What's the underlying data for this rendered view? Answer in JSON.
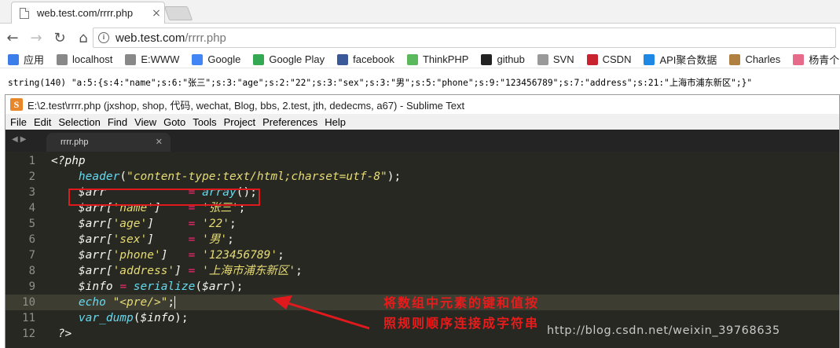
{
  "browser": {
    "tab_title": "web.test.com/rrrr.php",
    "url_host": "web.test.com",
    "url_path": "/rrrr.php",
    "bookmarks": [
      {
        "label": "应用",
        "icon": "apps-grid-icon",
        "color": "#3b7de9"
      },
      {
        "label": "localhost",
        "icon": "page-icon",
        "color": "#888888"
      },
      {
        "label": "E:WWW",
        "icon": "page-icon",
        "color": "#888888"
      },
      {
        "label": "Google",
        "icon": "google-icon",
        "color": "#4285f4"
      },
      {
        "label": "Google Play",
        "icon": "google-play-icon",
        "color": "#34a853"
      },
      {
        "label": "facebook",
        "icon": "facebook-icon",
        "color": "#3b5998"
      },
      {
        "label": "ThinkPHP",
        "icon": "thinkphp-icon",
        "color": "#5cb85c"
      },
      {
        "label": "github",
        "icon": "github-icon",
        "color": "#222222"
      },
      {
        "label": "SVN",
        "icon": "svn-icon",
        "color": "#999999"
      },
      {
        "label": "CSDN",
        "icon": "csdn-icon",
        "color": "#c9232f"
      },
      {
        "label": "API聚合数据",
        "icon": "juhe-icon",
        "color": "#1e88e5"
      },
      {
        "label": "Charles",
        "icon": "charles-icon",
        "color": "#b08040"
      },
      {
        "label": "杨青个人博",
        "icon": "heart-icon",
        "color": "#e66a8a"
      }
    ]
  },
  "page_output": "string(140) \"a:5:{s:4:\"name\";s:6:\"张三\";s:3:\"age\";s:2:\"22\";s:3:\"sex\";s:3:\"男\";s:5:\"phone\";s:9:\"123456789\";s:7:\"address\";s:21:\"上海市浦东新区\";}\"",
  "sublime": {
    "title": "E:\\2.test\\rrrr.php (jxshop, shop, 代码, wechat, Blog, bbs, 2.test, jth, dedecms, a67) - Sublime Text",
    "menu": [
      "File",
      "Edit",
      "Selection",
      "Find",
      "View",
      "Goto",
      "Tools",
      "Project",
      "Preferences",
      "Help"
    ],
    "tab": "rrrr.php",
    "active_line": 10,
    "lines": [
      [
        {
          "t": "<?php",
          "c": "k-tag"
        }
      ],
      [
        {
          "t": "    "
        },
        {
          "t": "header",
          "c": "k-fn"
        },
        {
          "t": "("
        },
        {
          "t": "\"content-type:text/html;charset=utf-8\"",
          "c": "k-str"
        },
        {
          "t": ");"
        }
      ],
      [
        {
          "t": "    "
        },
        {
          "t": "$arr",
          "c": "k-var"
        },
        {
          "t": "            "
        },
        {
          "t": "=",
          "c": "k-op"
        },
        {
          "t": " "
        },
        {
          "t": "array",
          "c": "k-fn"
        },
        {
          "t": "();"
        }
      ],
      [
        {
          "t": "    "
        },
        {
          "t": "$arr[",
          "c": "k-var"
        },
        {
          "t": "'name'",
          "c": "k-str"
        },
        {
          "t": "]",
          "c": "k-var"
        },
        {
          "t": "    "
        },
        {
          "t": "=",
          "c": "k-op"
        },
        {
          "t": " "
        },
        {
          "t": "'张三'",
          "c": "k-str"
        },
        {
          "t": ";"
        }
      ],
      [
        {
          "t": "    "
        },
        {
          "t": "$arr[",
          "c": "k-var"
        },
        {
          "t": "'age'",
          "c": "k-str"
        },
        {
          "t": "]",
          "c": "k-var"
        },
        {
          "t": "     "
        },
        {
          "t": "=",
          "c": "k-op"
        },
        {
          "t": " "
        },
        {
          "t": "'22'",
          "c": "k-str"
        },
        {
          "t": ";"
        }
      ],
      [
        {
          "t": "    "
        },
        {
          "t": "$arr[",
          "c": "k-var"
        },
        {
          "t": "'sex'",
          "c": "k-str"
        },
        {
          "t": "]",
          "c": "k-var"
        },
        {
          "t": "     "
        },
        {
          "t": "=",
          "c": "k-op"
        },
        {
          "t": " "
        },
        {
          "t": "'男'",
          "c": "k-str"
        },
        {
          "t": ";"
        }
      ],
      [
        {
          "t": "    "
        },
        {
          "t": "$arr[",
          "c": "k-var"
        },
        {
          "t": "'phone'",
          "c": "k-str"
        },
        {
          "t": "]",
          "c": "k-var"
        },
        {
          "t": "   "
        },
        {
          "t": "=",
          "c": "k-op"
        },
        {
          "t": " "
        },
        {
          "t": "'123456789'",
          "c": "k-str"
        },
        {
          "t": ";"
        }
      ],
      [
        {
          "t": "    "
        },
        {
          "t": "$arr[",
          "c": "k-var"
        },
        {
          "t": "'address'",
          "c": "k-str"
        },
        {
          "t": "]",
          "c": "k-var"
        },
        {
          "t": " "
        },
        {
          "t": "=",
          "c": "k-op"
        },
        {
          "t": " "
        },
        {
          "t": "'上海市浦东新区'",
          "c": "k-str"
        },
        {
          "t": ";"
        }
      ],
      [
        {
          "t": "    "
        },
        {
          "t": "$info",
          "c": "k-var"
        },
        {
          "t": " "
        },
        {
          "t": "=",
          "c": "k-op"
        },
        {
          "t": " "
        },
        {
          "t": "serialize",
          "c": "k-fn"
        },
        {
          "t": "("
        },
        {
          "t": "$arr",
          "c": "k-var"
        },
        {
          "t": ");"
        }
      ],
      [
        {
          "t": "    "
        },
        {
          "t": "echo",
          "c": "k-fn"
        },
        {
          "t": " "
        },
        {
          "t": "\"<pre/>\"",
          "c": "k-str"
        },
        {
          "t": ";"
        },
        {
          "t": "|",
          "c": "cursor"
        }
      ],
      [
        {
          "t": "    "
        },
        {
          "t": "var_dump",
          "c": "k-fn"
        },
        {
          "t": "("
        },
        {
          "t": "$info",
          "c": "k-var"
        },
        {
          "t": ");"
        }
      ],
      [
        {
          "t": " ?>",
          "c": "k-tag"
        }
      ]
    ]
  },
  "annotation": {
    "line1": "将数组中元素的键和值按",
    "line2": "照规则顺序连接成字符串",
    "color": "#ea1b1b"
  },
  "watermark": "http://blog.csdn.net/weixin_39768635"
}
